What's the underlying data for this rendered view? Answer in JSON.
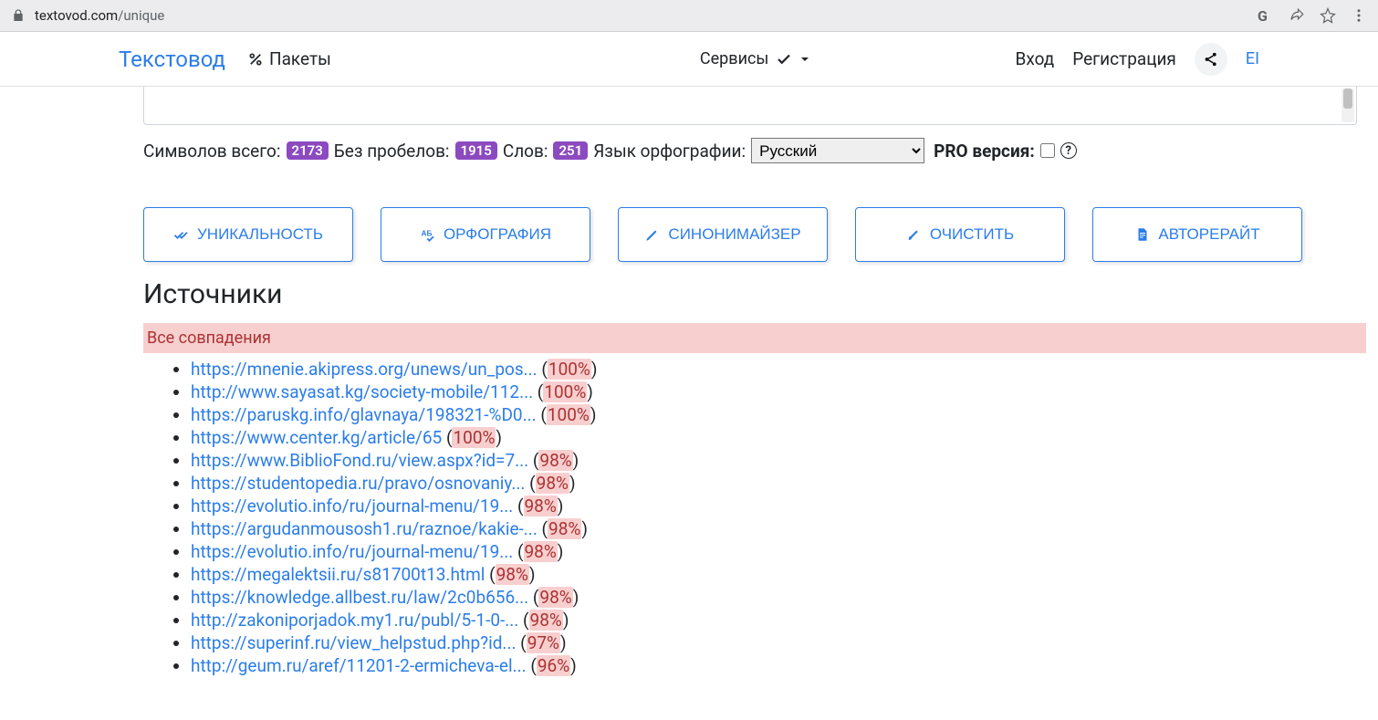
{
  "browser": {
    "domain": "textovod.com",
    "path": "/unique"
  },
  "nav": {
    "brand": "Текстовод",
    "packages": "Пакеты",
    "services": "Сервисы",
    "login": "Вход",
    "register": "Регистрация",
    "lang_short": "EI"
  },
  "stats": {
    "total_label": "Символов всего:",
    "total": "2173",
    "nospace_label": "Без пробелов:",
    "nospace": "1915",
    "words_label": "Слов:",
    "words": "251",
    "orth_label": "Язык орфографии:",
    "lang_selected": "Русский",
    "pro_label": "PRO версия:"
  },
  "buttons": {
    "unique": "УНИКАЛЬНОСТЬ",
    "ortho": "ОРФОГРАФИЯ",
    "syn": "СИНОНИМАЙЗЕР",
    "clear": "ОЧИСТИТЬ",
    "rewrite": "АВТОРЕРАЙТ"
  },
  "sources": {
    "heading": "Источники",
    "all_matches": "Все совпадения",
    "items": [
      {
        "url": "https://mnenie.akipress.org/unews/un_pos...",
        "pct": "100%"
      },
      {
        "url": "http://www.sayasat.kg/society-mobile/112...",
        "pct": "100%"
      },
      {
        "url": "https://paruskg.info/glavnaya/198321-%D0...",
        "pct": "100%"
      },
      {
        "url": "https://www.center.kg/article/65",
        "pct": "100%"
      },
      {
        "url": "https://www.BiblioFond.ru/view.aspx?id=7...",
        "pct": "98%"
      },
      {
        "url": "https://studentopedia.ru/pravo/osnovaniy...",
        "pct": "98%"
      },
      {
        "url": "https://evolutio.info/ru/journal-menu/19...",
        "pct": "98%"
      },
      {
        "url": "https://argudanmousosh1.ru/raznoe/kakie-...",
        "pct": "98%"
      },
      {
        "url": "https://evolutio.info/ru/journal-menu/19...",
        "pct": "98%"
      },
      {
        "url": "https://megalektsii.ru/s81700t13.html",
        "pct": "98%"
      },
      {
        "url": "https://knowledge.allbest.ru/law/2c0b656...",
        "pct": "98%"
      },
      {
        "url": "http://zakoniporjadok.my1.ru/publ/5-1-0-...",
        "pct": "98%"
      },
      {
        "url": "https://superinf.ru/view_helpstud.php?id...",
        "pct": "97%"
      },
      {
        "url": "http://geum.ru/aref/11201-2-ermicheva-el...",
        "pct": "96%"
      }
    ]
  }
}
